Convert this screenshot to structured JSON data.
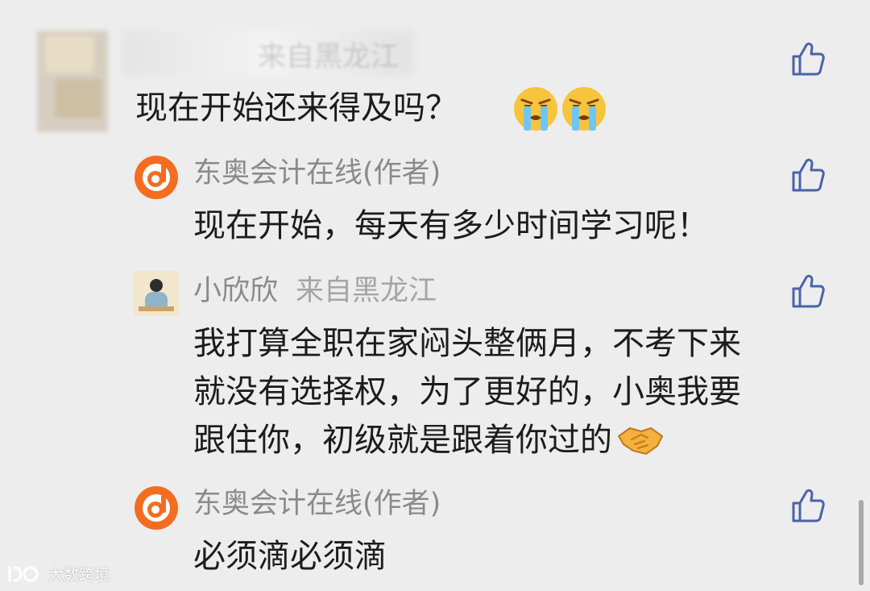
{
  "comments": [
    {
      "name": "来自黑龙江",
      "text": "现在开始还来得及吗？",
      "emojis": [
        "crying-face-icon",
        "crying-face-icon"
      ]
    },
    {
      "name": "东奥会计在线(作者)",
      "text": "现在开始，每天有多少时间学习呢！"
    },
    {
      "name": "小欣欣",
      "location": "来自黑龙江",
      "lines": [
        "我打算全职在家闷头整俩月，不考下来",
        "就没有选择权，为了更好的，小奥我要",
        "跟住你，初级就是跟着你过的"
      ],
      "emoji": "handshake-icon"
    },
    {
      "name": "东奥会计在线(作者)",
      "text": "必须滴必须滴"
    }
  ],
  "watermark": {
    "text": "大数跨境"
  },
  "colors": {
    "background": "#ededed",
    "like_icon": "#4a62a8",
    "brand_orange": "#f36d21",
    "name_gray": "#8a8a8a"
  }
}
